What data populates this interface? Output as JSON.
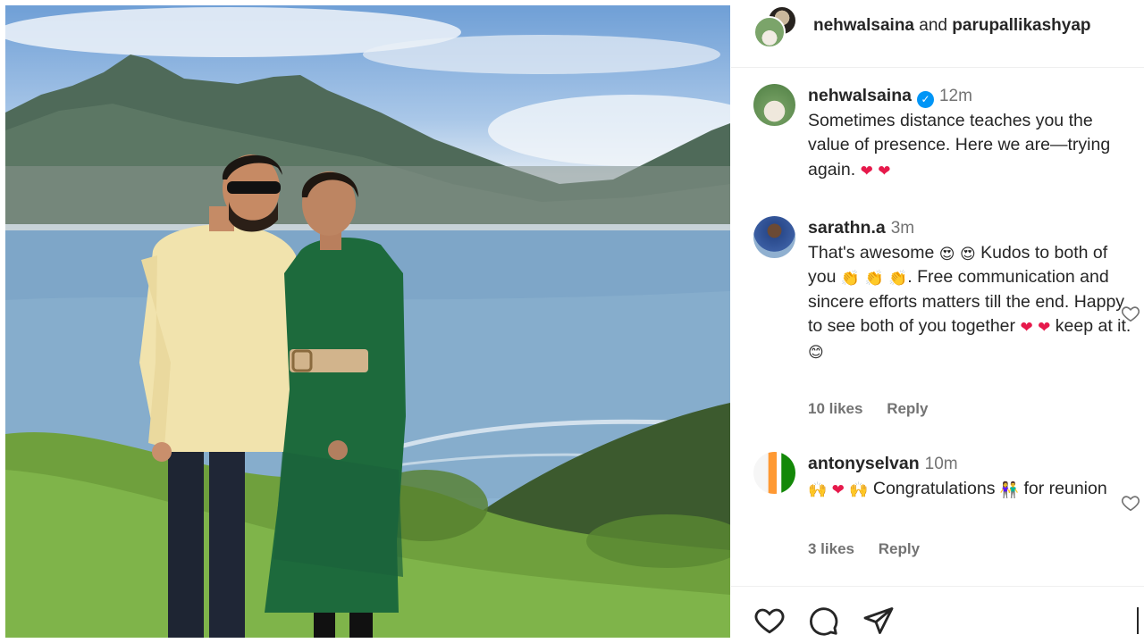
{
  "post": {
    "author1": "nehwalsaina",
    "connector": "and",
    "author2": "parupallikashyap"
  },
  "caption": {
    "username": "nehwalsaina",
    "time": "12m",
    "text": "Sometimes distance teaches you the value of presence. Here we are—trying again."
  },
  "comments": [
    {
      "username": "sarathn.a",
      "time": "3m",
      "text_1": "That's awesome",
      "text_2": "Kudos to both of you",
      "text_3": ". Free communication and sincere efforts matters till the end. Happy to see both of you together",
      "text_4": "keep at it.",
      "likes": "10 likes",
      "reply": "Reply"
    },
    {
      "username": "antonyselvan",
      "time": "10m",
      "text_1": "Congratulations",
      "text_2": "for reunion",
      "likes": "3 likes",
      "reply": "Reply"
    }
  ],
  "icons": {
    "like": "heart-icon",
    "comment": "comment-icon",
    "share": "send-icon",
    "verified": "verified-badge-icon"
  },
  "colors": {
    "verified": "#0095f6",
    "heart": "#e6194b",
    "muted": "#737373"
  }
}
